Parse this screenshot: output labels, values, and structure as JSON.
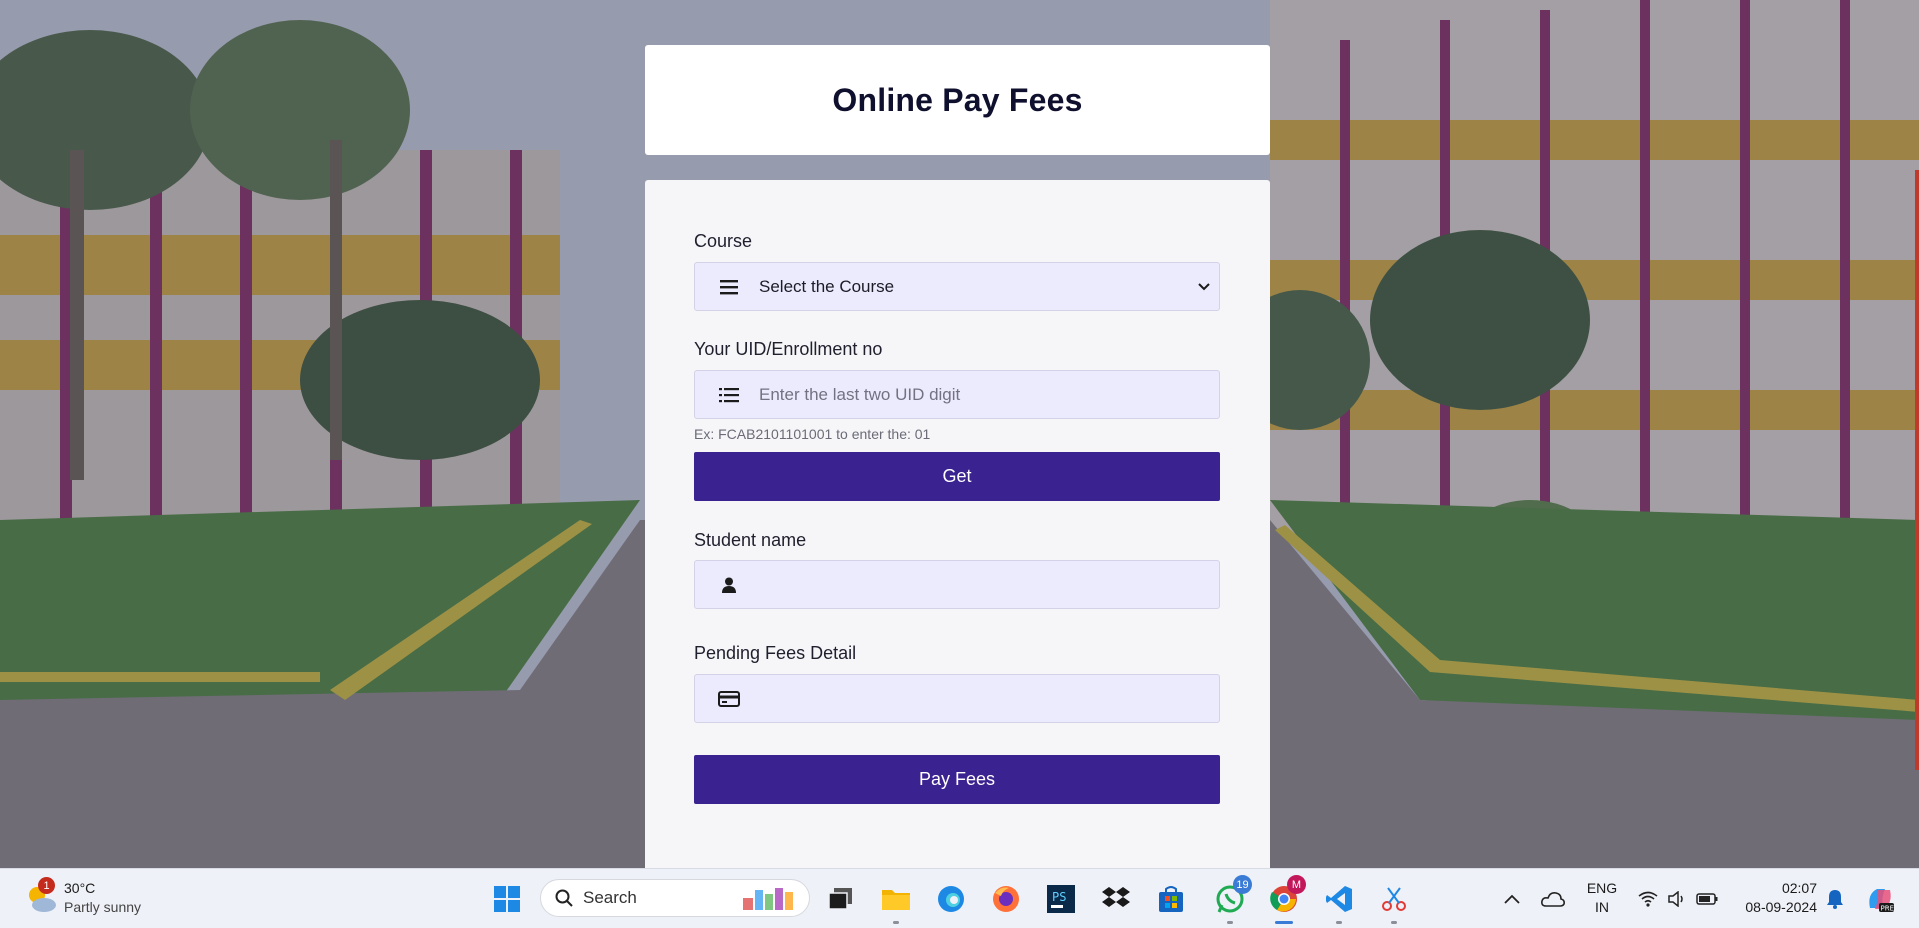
{
  "page": {
    "title": "Online Pay Fees"
  },
  "form": {
    "course": {
      "label": "Course",
      "selected_value": "Select the Course",
      "icon": "menu-icon"
    },
    "uid": {
      "label": "Your UID/Enrollment no",
      "placeholder": "Enter the last two UID digit",
      "hint": "Ex: FCAB2101101001 to enter the: 01",
      "icon": "list-icon"
    },
    "get_button": "Get",
    "student_name": {
      "label": "Student name",
      "value": "",
      "icon": "user-icon"
    },
    "pending_fees": {
      "label": "Pending Fees Detail",
      "value": "",
      "icon": "credit-card-icon"
    },
    "pay_button": "Pay Fees"
  },
  "taskbar": {
    "weather": {
      "temperature": "30°C",
      "description": "Partly sunny",
      "badge": "1"
    },
    "search_label": "Search",
    "apps": [
      {
        "name": "windows-start",
        "icon": "windows-icon"
      },
      {
        "name": "task-view",
        "icon": "task-view-icon"
      },
      {
        "name": "file-explorer",
        "icon": "folder-icon"
      },
      {
        "name": "edge",
        "icon": "edge-icon"
      },
      {
        "name": "firefox",
        "icon": "firefox-icon"
      },
      {
        "name": "pycharm",
        "icon": "ide-icon"
      },
      {
        "name": "dropbox",
        "icon": "dropbox-icon"
      },
      {
        "name": "microsoft-store",
        "icon": "store-icon"
      },
      {
        "name": "whatsapp",
        "icon": "whatsapp-icon",
        "badge": "19"
      },
      {
        "name": "chrome",
        "icon": "chrome-icon",
        "badge": "M"
      },
      {
        "name": "vscode",
        "icon": "vscode-icon"
      },
      {
        "name": "snipping-tool",
        "icon": "snipping-icon"
      }
    ],
    "tray": {
      "language_line1": "ENG",
      "language_line2": "IN",
      "time": "02:07",
      "date": "08-09-2024"
    }
  },
  "colors": {
    "primary_button": "#3b2291",
    "field_background": "#ecebfd",
    "title": "#0f0f2e"
  }
}
